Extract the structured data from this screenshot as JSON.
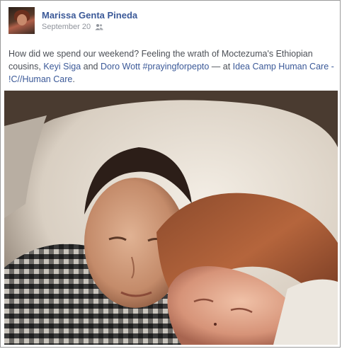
{
  "post": {
    "author": "Marissa Genta Pineda",
    "date": "September 20",
    "audience_icon": "friends-icon",
    "text_before": "How did we spend our weekend? Feeling the wrath of Moctezuma's Ethiopian cousins, ",
    "tagged_1": "Keyi Siga",
    "and_text": " and ",
    "tagged_2": "Doro Wott",
    "space": " ",
    "hashtag": "#prayingforpepto",
    "at_text": " — at ",
    "location": "Idea Camp Human Care - !C//Human Care",
    "period": "."
  },
  "colors": {
    "link": "#3b5998",
    "text": "#4b4f56",
    "meta": "#90949c"
  }
}
